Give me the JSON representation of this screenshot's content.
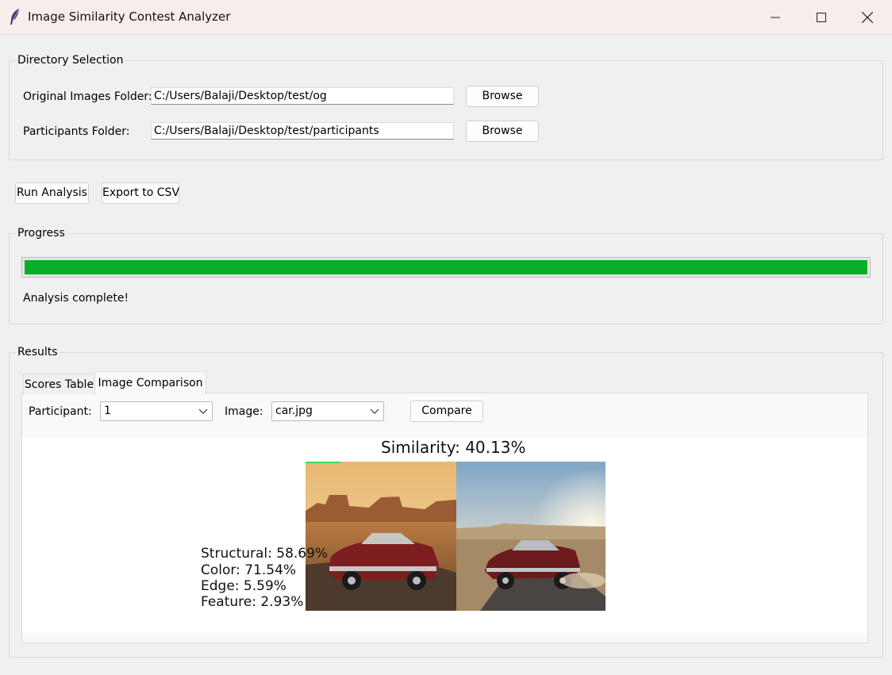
{
  "window": {
    "title": "Image Similarity Contest Analyzer",
    "app_icon": "feather-icon",
    "controls": [
      "minimize-icon",
      "maximize-icon",
      "close-icon"
    ]
  },
  "directory_selection": {
    "legend": "Directory Selection",
    "original_label": "Original Images Folder:",
    "original_value": "C:/Users/Balaji/Desktop/test/og",
    "original_browse": "Browse",
    "participants_label": "Participants Folder:",
    "participants_value": "C:/Users/Balaji/Desktop/test/participants",
    "participants_browse": "Browse"
  },
  "actions": {
    "run_label": "Run Analysis",
    "export_label": "Export to CSV"
  },
  "progress": {
    "legend": "Progress",
    "percent": 100,
    "fill_color": "#06b025",
    "status": "Analysis complete!"
  },
  "results": {
    "legend": "Results",
    "tabs": [
      {
        "label": "Scores Table",
        "active": false
      },
      {
        "label": "Image Comparison",
        "active": true
      }
    ],
    "participant_label": "Participant:",
    "participant_value": "1",
    "image_label": "Image:",
    "image_value": "car.jpg",
    "compare_label": "Compare",
    "similarity_title": "Similarity: 40.13%",
    "metrics": [
      "Structural: 58.69%",
      "Color: 71.54%",
      "Edge: 5.59%",
      "Feature: 2.93%"
    ]
  }
}
